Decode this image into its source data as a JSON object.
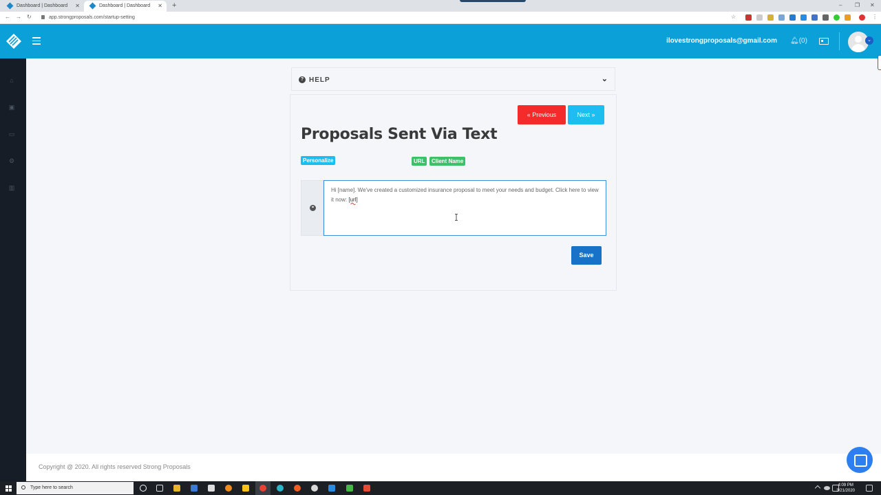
{
  "browser": {
    "tabs": [
      {
        "title": "Dashboard | Dashboard",
        "active": false
      },
      {
        "title": "Dashboard | Dashboard",
        "active": true
      }
    ],
    "url": "app.strongproposals.com/startup-setting"
  },
  "header": {
    "email": "ilovestrongproposals@gmail.com",
    "notifications": "(0)",
    "brand_color": "#0ca0d9"
  },
  "sidebar": {
    "icons": [
      "home-icon",
      "contacts-icon",
      "id-card-icon",
      "settings-icon",
      "chart-icon"
    ]
  },
  "help": {
    "label": "HELP"
  },
  "main": {
    "prev_label": "« Previous",
    "next_label": "Next »",
    "title": "Proposals Sent Via Text",
    "personalize_label": "Personalize",
    "tags": {
      "url": "URL",
      "client_name": "Client Name"
    },
    "message_prefix": "Hi [name]. We've created a customized insurance proposal to meet your needs and budget. Click here to view it now: ",
    "message_url_token": "[url]",
    "save_label": "Save"
  },
  "footer": {
    "copyright": "Copyright @ 2020. All rights reserved Strong Proposals"
  },
  "taskbar": {
    "search_placeholder": "Type here to search",
    "time": "4:09 PM",
    "date": "3/21/2020"
  }
}
